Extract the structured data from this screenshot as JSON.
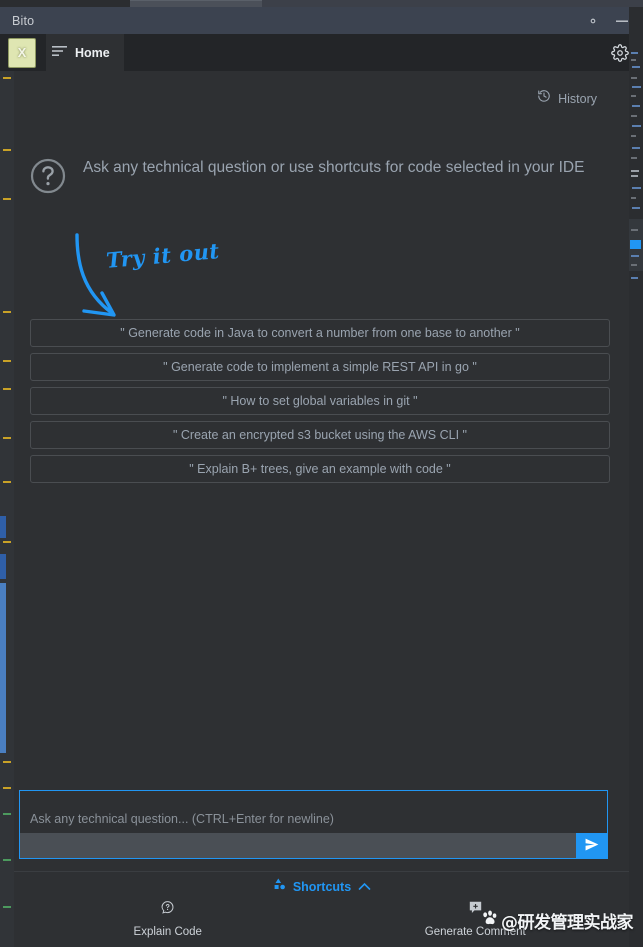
{
  "window": {
    "title": "Bito",
    "settings_icon": "gear-icon",
    "minimize_icon": "minimize-icon"
  },
  "tabbar": {
    "logo_text": "X",
    "home_tab": "Home",
    "menu_icon": "list-lines-icon",
    "settings_icon": "gear-icon"
  },
  "toolbar": {
    "history_label": "History",
    "history_icon": "history-clock-icon"
  },
  "hero": {
    "icon": "question-mark-circle-icon",
    "text": "Ask any technical question or use shortcuts for code selected in your IDE"
  },
  "annotation": {
    "label": "Try it out",
    "arrow_icon": "curved-arrow-icon",
    "color": "#2196f3"
  },
  "suggestions": [
    "\" Generate code in Java to convert a number from one base to another \"",
    "\" Generate code to implement a simple REST API in go \"",
    "\" How to set global variables in git \"",
    "\" Create an encrypted s3 bucket using the AWS CLI \"",
    "\" Explain B+ trees, give an example with code \""
  ],
  "composer": {
    "placeholder": "Ask any technical question... (CTRL+Enter for newline)",
    "value": "",
    "send_icon": "send-paper-plane-icon",
    "accent_color": "#2196f3"
  },
  "bottom": {
    "shortcuts_label": "Shortcuts",
    "shortcuts_icon": "shapes-icon",
    "chevron_icon": "chevron-up-icon",
    "items": [
      {
        "label": "Explain Code",
        "icon": "question-bubble-icon"
      },
      {
        "label": "Generate Comment",
        "icon": "comment-plus-icon"
      }
    ]
  },
  "watermark": {
    "icon": "paw-print-icon",
    "text": "@研发管理实战家"
  }
}
